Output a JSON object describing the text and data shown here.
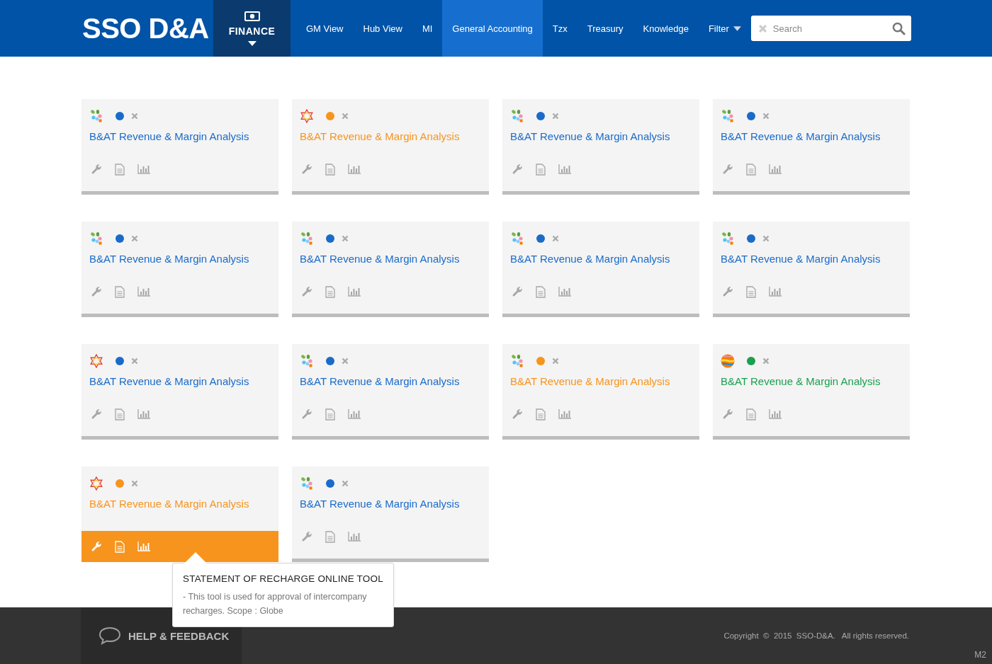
{
  "logo": "SSO D&A",
  "section": {
    "label": "FINANCE"
  },
  "nav": [
    {
      "label": "GM View",
      "selected": false
    },
    {
      "label": "Hub View",
      "selected": false
    },
    {
      "label": "MI",
      "selected": false
    },
    {
      "label": "General Accounting",
      "selected": true
    },
    {
      "label": "Tzx",
      "selected": false
    },
    {
      "label": "Treasury",
      "selected": false
    },
    {
      "label": "Knowledge",
      "selected": false
    }
  ],
  "filter": {
    "label": "Filter"
  },
  "search": {
    "placeholder": "Search"
  },
  "tiles": [
    {
      "kind": "flower",
      "color": "#1a6bc9",
      "title": "B&AT Revenue & Margin Analysis",
      "active": false
    },
    {
      "kind": "star",
      "color": "#f7941d",
      "title": "B&AT Revenue & Margin Analysis",
      "active": false
    },
    {
      "kind": "flower",
      "color": "#1a6bc9",
      "title": "B&AT Revenue & Margin Analysis",
      "active": false
    },
    {
      "kind": "flower",
      "color": "#1a6bc9",
      "title": "B&AT Revenue & Margin Analysis",
      "active": false
    },
    {
      "kind": "flower",
      "color": "#1a6bc9",
      "title": "B&AT Revenue & Margin Analysis",
      "active": false
    },
    {
      "kind": "flower",
      "color": "#1a6bc9",
      "title": "B&AT Revenue & Margin Analysis",
      "active": false
    },
    {
      "kind": "flower",
      "color": "#1a6bc9",
      "title": "B&AT Revenue & Margin Analysis",
      "active": false
    },
    {
      "kind": "flower",
      "color": "#1a6bc9",
      "title": "B&AT Revenue & Margin Analysis",
      "active": false
    },
    {
      "kind": "star",
      "color": "#1a6bc9",
      "title": "B&AT Revenue & Margin Analysis",
      "active": false
    },
    {
      "kind": "flower",
      "color": "#1a6bc9",
      "title": "B&AT Revenue & Margin Analysis",
      "active": false
    },
    {
      "kind": "flower",
      "color": "#f7941d",
      "title": "B&AT Revenue & Margin Analysis",
      "active": false
    },
    {
      "kind": "ball",
      "color": "#1aa050",
      "title": "B&AT Revenue & Margin Analysis",
      "active": false
    },
    {
      "kind": "star",
      "color": "#f7941d",
      "title": "B&AT Revenue & Margin Analysis",
      "active": true
    },
    {
      "kind": "flower",
      "color": "#1a6bc9",
      "title": "B&AT Revenue & Margin Analysis",
      "active": false
    }
  ],
  "tooltip": {
    "title": "STATEMENT OF RECHARGE ONLINE TOOL",
    "text": "- This tool is used for approval of intercompany recharges. Scope : Globe"
  },
  "footer": {
    "help": "HELP & FEEDBACK",
    "copyright": "Copyright  ©  2015  SSO-D&A.   All rights reserved.",
    "version": "M2"
  }
}
